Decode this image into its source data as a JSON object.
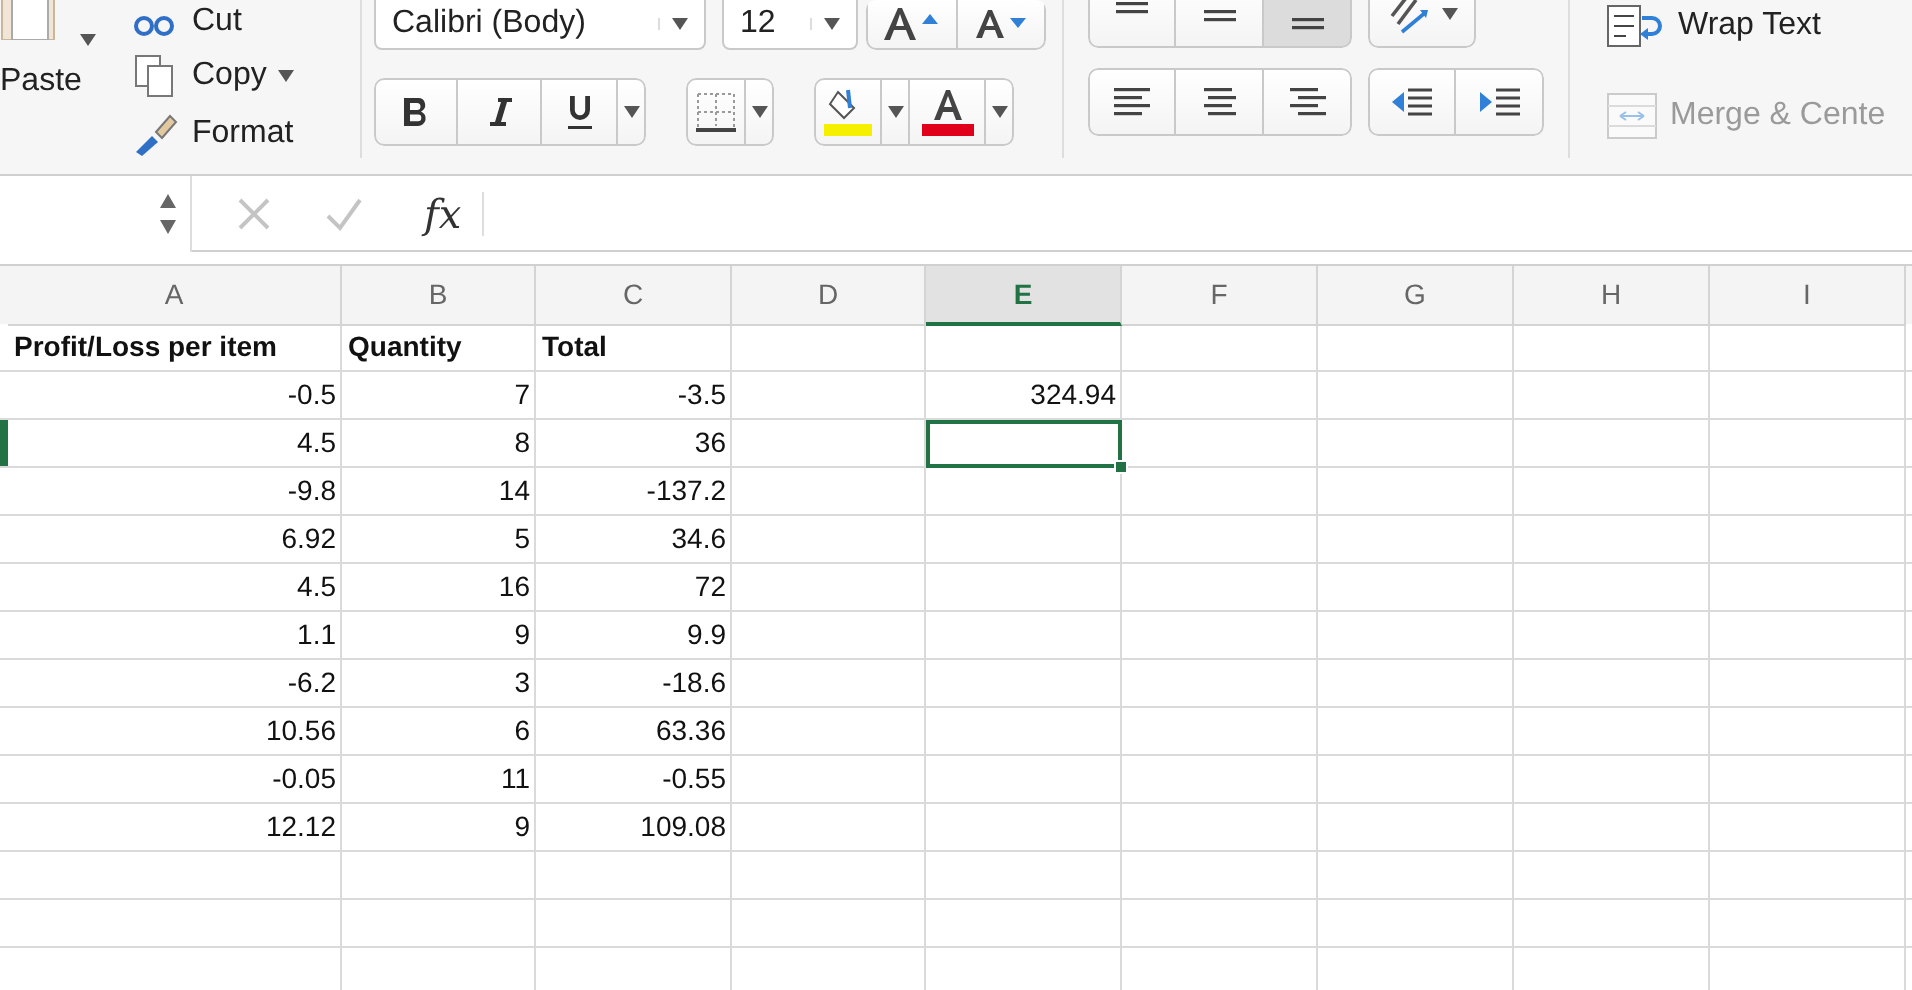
{
  "ribbon": {
    "clipboard": {
      "paste": "Paste",
      "cut": "Cut",
      "copy": "Copy",
      "format": "Format"
    },
    "font": {
      "name": "Calibri (Body)",
      "size": "12",
      "bold": false,
      "italic": false,
      "underline": false
    },
    "vertical_align": [
      {
        "selected": false
      },
      {
        "selected": false
      },
      {
        "selected": true
      }
    ],
    "horizontal_align": [
      {
        "selected": false
      },
      {
        "selected": false
      },
      {
        "selected": false
      }
    ],
    "wrap_text": "Wrap Text",
    "merge": {
      "label": "Merge & Cente",
      "disabled": true
    }
  },
  "formula_bar": {
    "function_label": "fx"
  },
  "sheet": {
    "columns": [
      {
        "label": "A",
        "selected": false
      },
      {
        "label": "B",
        "selected": false
      },
      {
        "label": "C",
        "selected": false
      },
      {
        "label": "D",
        "selected": false
      },
      {
        "label": "E",
        "selected": true
      },
      {
        "label": "F",
        "selected": false
      },
      {
        "label": "G",
        "selected": false
      },
      {
        "label": "H",
        "selected": false
      },
      {
        "label": "I",
        "selected": false
      }
    ],
    "rows": [
      {
        "kind": "header",
        "selected": false,
        "a": "Profit/Loss per item",
        "b": "Quantity",
        "c": "Total"
      },
      {
        "kind": "data",
        "selected": false,
        "a": "-0.5",
        "b": "7",
        "c": "-3.5",
        "e": "324.94"
      },
      {
        "kind": "data",
        "selected": true,
        "a": "4.5",
        "b": "8",
        "c": "36"
      },
      {
        "kind": "data",
        "selected": false,
        "a": "-9.8",
        "b": "14",
        "c": "-137.2"
      },
      {
        "kind": "data",
        "selected": false,
        "a": "6.92",
        "b": "5",
        "c": "34.6"
      },
      {
        "kind": "data",
        "selected": false,
        "a": "4.5",
        "b": "16",
        "c": "72"
      },
      {
        "kind": "data",
        "selected": false,
        "a": "1.1",
        "b": "9",
        "c": "9.9"
      },
      {
        "kind": "data",
        "selected": false,
        "a": "-6.2",
        "b": "3",
        "c": "-18.6"
      },
      {
        "kind": "data",
        "selected": false,
        "a": "10.56",
        "b": "6",
        "c": "63.36"
      },
      {
        "kind": "data",
        "selected": false,
        "a": "-0.05",
        "b": "11",
        "c": "-0.55"
      },
      {
        "kind": "data",
        "selected": false,
        "a": "12.12",
        "b": "9",
        "c": "109.08"
      }
    ]
  }
}
